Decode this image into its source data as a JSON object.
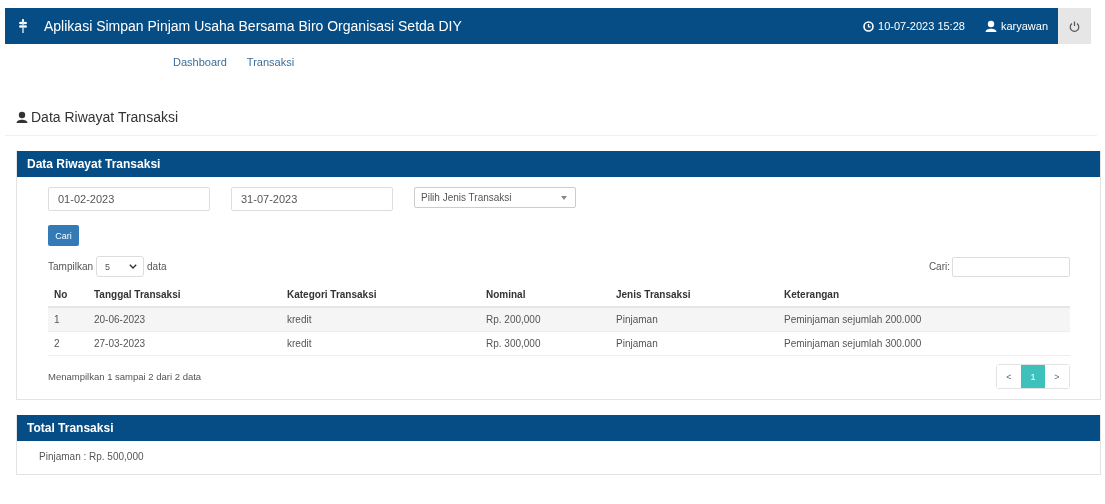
{
  "header": {
    "title": "Aplikasi Simpan Pinjam Usaha Bersama Biro Organisasi Setda DIY",
    "datetime": "10-07-2023 15:28",
    "user": "karyawan"
  },
  "nav": [
    {
      "label": "Dashboard"
    },
    {
      "label": "Transaksi"
    }
  ],
  "page_title": "Data Riwayat Transaksi",
  "history_panel": {
    "title": "Data Riwayat Transaksi",
    "filters": {
      "date_from": "01-02-2023",
      "date_to": "31-07-2023",
      "type_select": "Pilih Jenis Transaksi",
      "search_button": "Cari"
    },
    "length": {
      "label": "Tampilkan",
      "value": "5",
      "suffix": "data"
    },
    "search": {
      "label": "Cari:"
    },
    "table": {
      "columns": [
        "No",
        "Tanggal Transaksi",
        "Kategori Transaksi",
        "Nominal",
        "Jenis Transaksi",
        "Keterangan"
      ],
      "rows": [
        [
          "1",
          "20-06-2023",
          "kredit",
          "Rp. 200,000",
          "Pinjaman",
          "Peminjaman sejumlah 200.000"
        ],
        [
          "2",
          "27-03-2023",
          "kredit",
          "Rp. 300,000",
          "Pinjaman",
          "Peminjaman sejumlah 300.000"
        ]
      ]
    },
    "info": "Menampilkan 1 sampai 2 dari 2 data",
    "pagination": [
      {
        "label": "<",
        "selected": false
      },
      {
        "label": "1",
        "selected": true
      },
      {
        "label": ">",
        "selected": false
      }
    ]
  },
  "total_panel": {
    "title": "Total Transaksi",
    "text": "Pinjaman : Rp. 500,000"
  }
}
